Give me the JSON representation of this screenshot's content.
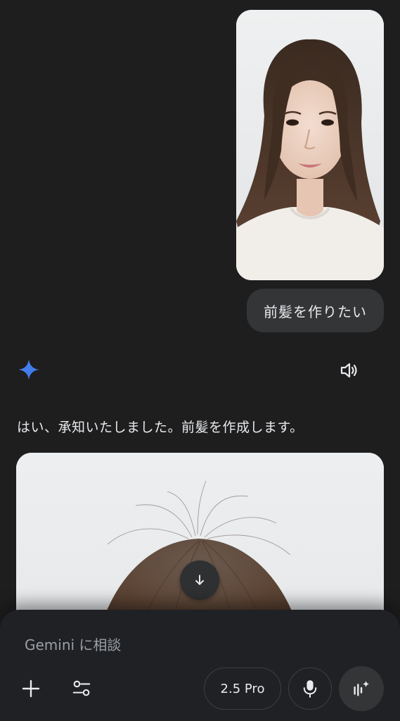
{
  "chat": {
    "user_message": "前髪を作りたい",
    "response_text": "はい、承知いたしました。前髪を作成します。"
  },
  "icons": {
    "assistant": "gemini-star-icon",
    "speaker": "speaker-icon",
    "scroll": "arrow-down-icon",
    "add": "plus-icon",
    "tools": "tools-icon",
    "mic": "mic-icon",
    "live": "live-sparkle-icon"
  },
  "input": {
    "placeholder": "Gemini に相談",
    "model_label": "2.5 Pro"
  },
  "colors": {
    "background": "#1e1e1f",
    "bubble": "#333537",
    "gemini_blue": "#4285f4"
  }
}
